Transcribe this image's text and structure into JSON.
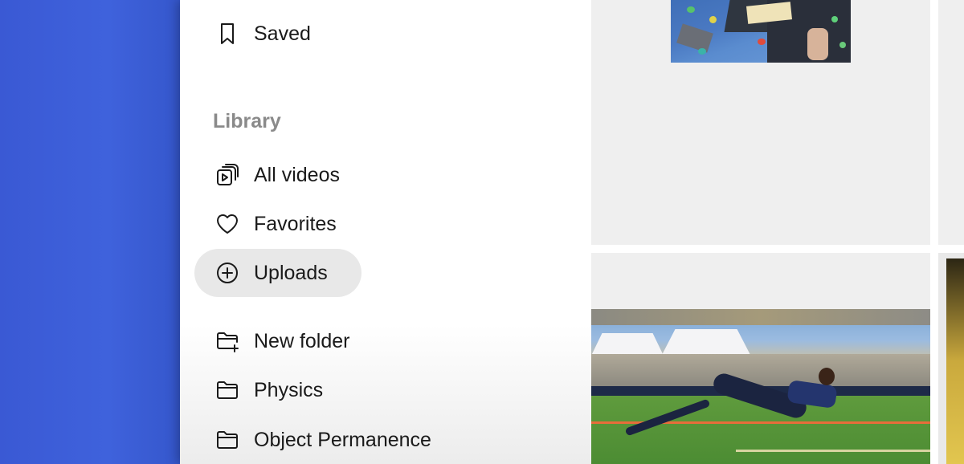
{
  "sidebar": {
    "saved_label": "Saved",
    "library_title": "Library",
    "items": [
      {
        "label": "All videos",
        "icon": "video-library-icon"
      },
      {
        "label": "Favorites",
        "icon": "heart-icon"
      },
      {
        "label": "Uploads",
        "icon": "plus-circle-icon",
        "active": true
      },
      {
        "label": "New folder",
        "icon": "folder-plus-icon"
      },
      {
        "label": "Physics",
        "icon": "folder-icon"
      },
      {
        "label": "Object Permanence",
        "icon": "folder-icon"
      }
    ]
  },
  "colors": {
    "background": "#3d5ed6",
    "sidebar": "#ffffff",
    "active_pill": "#e8e8e8",
    "text": "#1a1a1a",
    "section_title": "#8a8a8a"
  }
}
